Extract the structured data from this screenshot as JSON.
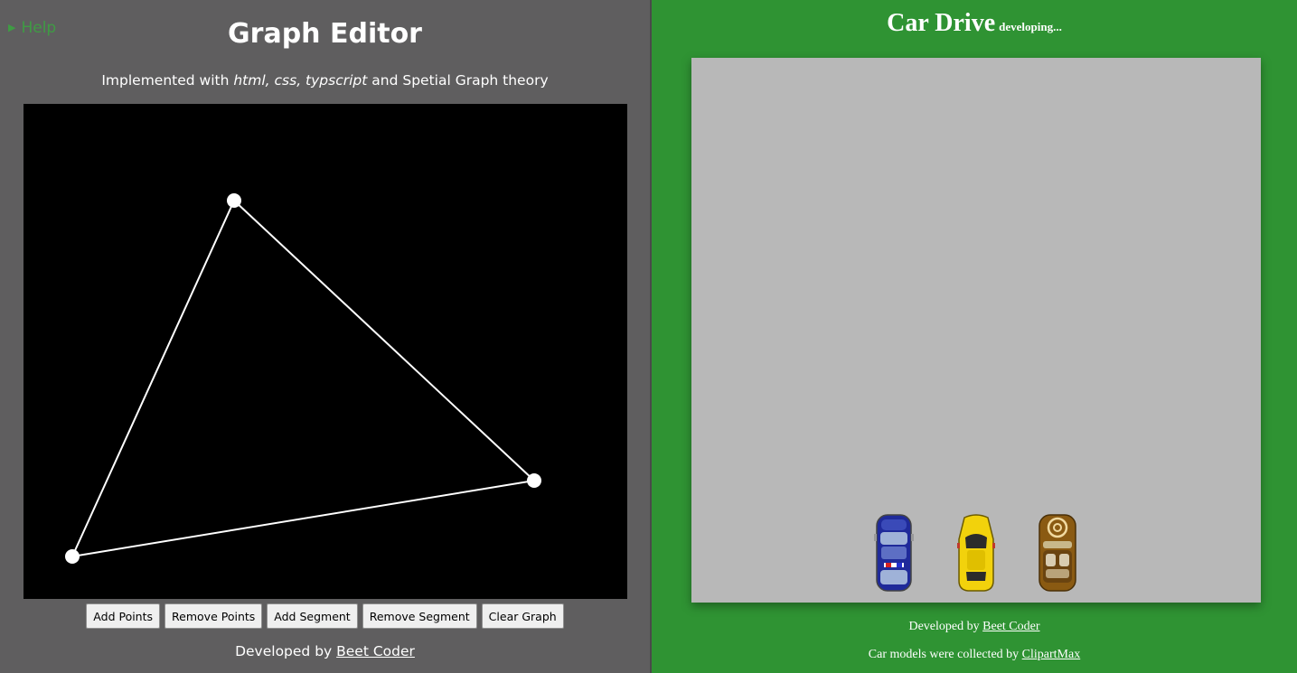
{
  "left_panel": {
    "help_label": "Help",
    "title": "Graph Editor",
    "subtitle": {
      "prefix": "Implemented with ",
      "tech": "html, css, typscript",
      "suffix": " and Spetial Graph theory"
    },
    "buttons": {
      "add_points": "Add Points",
      "remove_points": "Remove Points",
      "add_segment": "Add Segment",
      "remove_segment": "Remove Segment",
      "clear_graph": "Clear Graph"
    },
    "credit": {
      "prefix": "Developed by ",
      "link": "Beet Coder"
    }
  },
  "right_panel": {
    "title": "Car Drive",
    "badge": "developing...",
    "credit": {
      "prefix": "Developed by ",
      "link": "Beet Coder"
    },
    "models_credit": {
      "prefix": "Car models were collected by ",
      "link": "ClipartMax"
    }
  },
  "colors": {
    "left_bg": "#5f5e5f",
    "right_bg": "#2f9333",
    "road": "#b8b8b8",
    "help": "#3f9b44"
  }
}
